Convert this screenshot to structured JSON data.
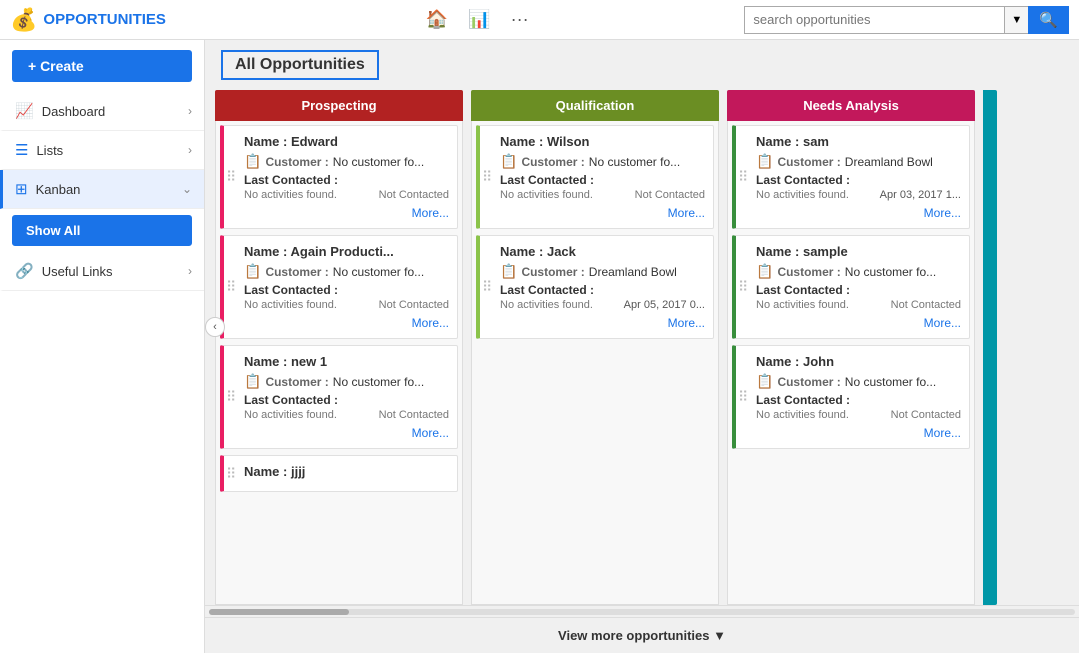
{
  "app": {
    "logo_icon": "💰",
    "title": "OPPORTUNITIES"
  },
  "nav": {
    "home_icon": "🏠",
    "chart_icon": "📊",
    "more_icon": "···",
    "search_placeholder": "search opportunities",
    "search_dropdown_icon": "▼",
    "search_button_icon": "🔍"
  },
  "sidebar": {
    "create_label": "+ Create",
    "items": [
      {
        "icon": "📈",
        "label": "Dashboard",
        "chevron": "›",
        "active": false
      },
      {
        "icon": "☰",
        "label": "Lists",
        "chevron": "›",
        "active": false
      },
      {
        "icon": "⊞",
        "label": "Kanban",
        "chevron": "⌄",
        "active": true
      }
    ],
    "show_all_label": "Show All",
    "useful_links_label": "Useful Links",
    "useful_links_chevron": "›"
  },
  "content": {
    "page_title": "All Opportunities"
  },
  "columns": [
    {
      "id": "prospecting",
      "label": "Prospecting",
      "color_class": "col-prospecting",
      "card_class": "card-prospecting",
      "cards": [
        {
          "name": "Edward",
          "customer": "No customer fo...",
          "last_contacted_label": "Last Contacted :",
          "activity": "No activities found.",
          "status": "Not Contacted",
          "date": "",
          "more": "More..."
        },
        {
          "name": "Again Producti...",
          "customer": "No customer fo...",
          "last_contacted_label": "Last Contacted :",
          "activity": "No activities found.",
          "status": "Not Contacted",
          "date": "",
          "more": "More..."
        },
        {
          "name": "new 1",
          "customer": "No customer fo...",
          "last_contacted_label": "Last Contacted :",
          "activity": "No activities found.",
          "status": "Not Contacted",
          "date": "",
          "more": "More..."
        },
        {
          "name": "jjjj",
          "customer": "",
          "last_contacted_label": "",
          "activity": "",
          "status": "",
          "date": "",
          "more": ""
        }
      ]
    },
    {
      "id": "qualification",
      "label": "Qualification",
      "color_class": "col-qualification",
      "card_class": "card-qualification",
      "cards": [
        {
          "name": "Wilson",
          "customer": "No customer fo...",
          "last_contacted_label": "Last Contacted :",
          "activity": "No activities found.",
          "status": "Not Contacted",
          "date": "",
          "more": "More..."
        },
        {
          "name": "Jack",
          "customer": "Dreamland Bowl",
          "last_contacted_label": "Last Contacted :",
          "activity": "No activities found.",
          "status": "",
          "date": "Apr 05, 2017 0...",
          "more": "More..."
        }
      ]
    },
    {
      "id": "needs-analysis",
      "label": "Needs Analysis",
      "color_class": "col-needs-analysis",
      "card_class": "card-needs-analysis",
      "cards": [
        {
          "name": "sam",
          "customer": "Dreamland Bowl",
          "last_contacted_label": "Last Contacted :",
          "activity": "No activities found.",
          "status": "",
          "date": "Apr 03, 2017 1...",
          "more": "More..."
        },
        {
          "name": "sample",
          "customer": "No customer fo...",
          "last_contacted_label": "Last Contacted :",
          "activity": "No activities found.",
          "status": "Not Contacted",
          "date": "",
          "more": "More..."
        },
        {
          "name": "John",
          "customer": "No customer fo...",
          "last_contacted_label": "Last Contacted :",
          "activity": "No activities found.",
          "status": "Not Contacted",
          "date": "",
          "more": "More..."
        }
      ]
    }
  ],
  "view_more": {
    "label": "View more opportunities ▼"
  },
  "customer_icon": "📋",
  "name_label": "Name :",
  "customer_label": "Customer :"
}
